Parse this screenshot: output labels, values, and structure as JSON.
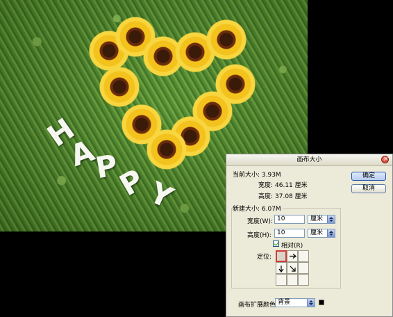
{
  "window": {
    "title": "画布大小"
  },
  "current_size": {
    "label": "当前大小: 3.93M",
    "width_label": "宽度:",
    "width_value": "46.11 厘米",
    "height_label": "高度:",
    "height_value": "37.08 厘米"
  },
  "new_size": {
    "label": "新建大小: 6.07M",
    "width_label": "宽度(W):",
    "width_value": "10",
    "width_unit": "厘米",
    "height_label": "高度(H):",
    "height_value": "10",
    "height_unit": "厘米",
    "relative_label": "相对(R)",
    "relative_checked": true,
    "anchor_label": "定位:"
  },
  "canvas_extension": {
    "label": "画布扩展颜色:",
    "value": "背景",
    "swatch_color": "#000000"
  },
  "buttons": {
    "ok": "确定",
    "cancel": "取消"
  },
  "photo": {
    "letters": [
      "H",
      "A",
      "P",
      "P",
      "Y"
    ]
  },
  "colors": {
    "dialog_bg": "#ecead8",
    "primary_button": "#b5cbef",
    "anchor_selected": "#d23a3a"
  }
}
